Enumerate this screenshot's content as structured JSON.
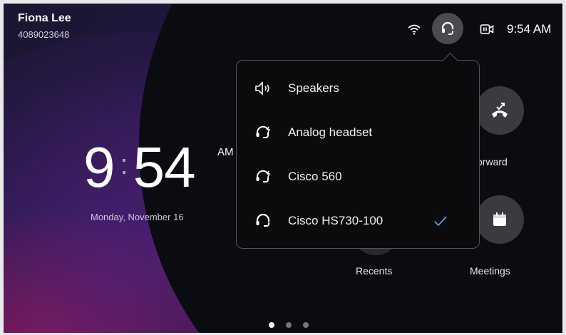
{
  "user": {
    "name": "Fiona Lee",
    "number": "4089023648"
  },
  "status_bar": {
    "time": "9:54 AM",
    "icons": [
      "wifi-icon",
      "headset-icon",
      "camera-icon"
    ]
  },
  "clock": {
    "hour": "9",
    "minute": "54",
    "ampm": "AM",
    "date": "Monday, November 16"
  },
  "tiles": {
    "forward": "orward",
    "recents": "Recents",
    "meetings": "Meetings"
  },
  "audio_menu": {
    "options": [
      {
        "label": "Speakers",
        "icon": "speaker-icon",
        "selected": false
      },
      {
        "label": "Analog headset",
        "icon": "analog-headset-icon",
        "selected": false
      },
      {
        "label": "Cisco 560",
        "icon": "cisco-560-headset-icon",
        "selected": false
      },
      {
        "label": "Cisco HS730-100",
        "icon": "headset-icon",
        "selected": true
      }
    ],
    "selected_color": "#5aa0e6"
  },
  "pager": {
    "count": 3,
    "active": 1
  }
}
